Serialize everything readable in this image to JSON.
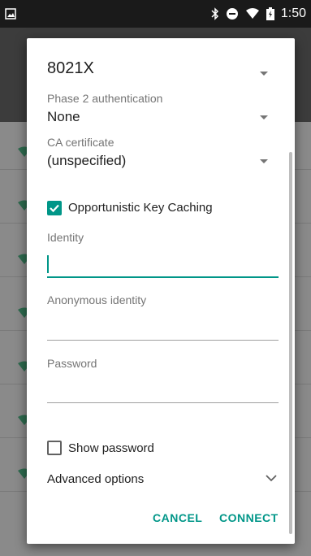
{
  "status_bar": {
    "time": "1:50",
    "icons": [
      "image-icon",
      "bluetooth-icon",
      "do-not-disturb-icon",
      "wifi-icon",
      "battery-icon"
    ]
  },
  "dialog": {
    "eap_method": "8021X",
    "phase2": {
      "label": "Phase 2 authentication",
      "value": "None"
    },
    "ca_certificate": {
      "label": "CA certificate",
      "value": "(unspecified)"
    },
    "opportunistic_key_caching": {
      "label": "Opportunistic Key Caching",
      "checked": true
    },
    "identity": {
      "label": "Identity",
      "value": ""
    },
    "anonymous_identity": {
      "label": "Anonymous identity",
      "value": ""
    },
    "password": {
      "label": "Password",
      "value": ""
    },
    "show_password": {
      "label": "Show password",
      "checked": false
    },
    "advanced_options": {
      "label": "Advanced options"
    },
    "cancel_label": "CANCEL",
    "connect_label": "CONNECT"
  },
  "colors": {
    "accent": "#009688",
    "status_bar": "#1a1a1a",
    "scrim": "#8a8a8a"
  }
}
